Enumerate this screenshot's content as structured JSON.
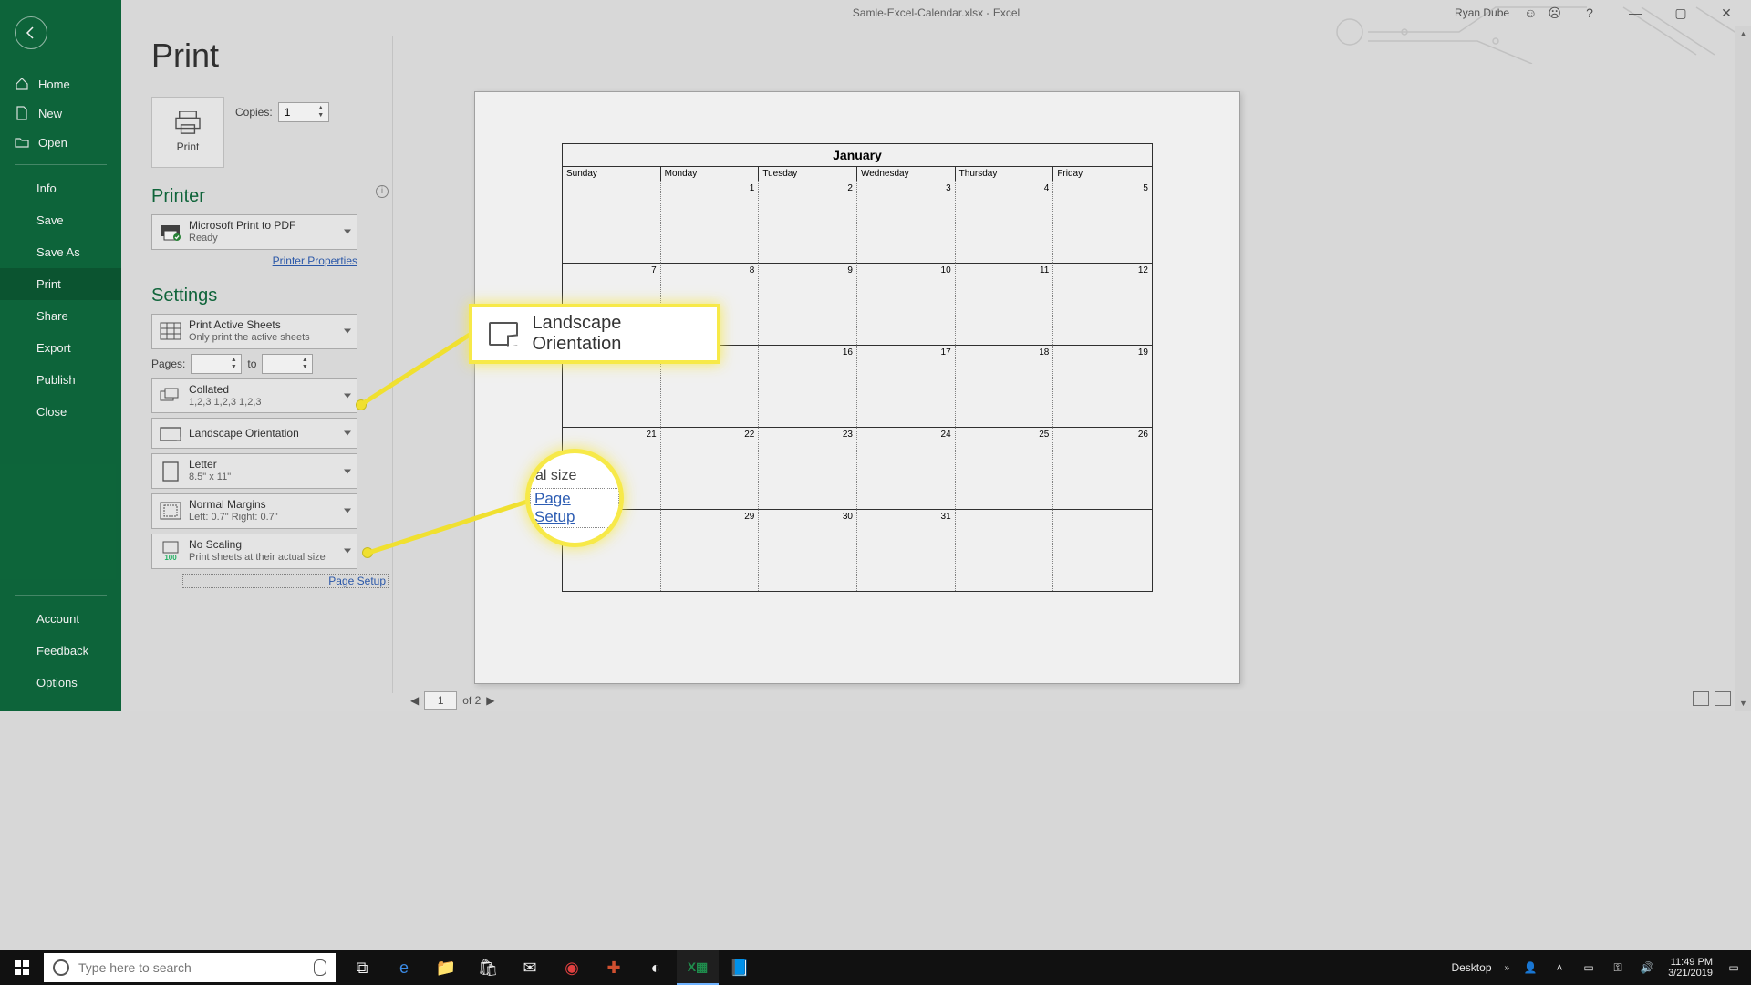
{
  "titlebar": {
    "filename": "Samle-Excel-Calendar.xlsx  -  Excel",
    "username": "Ryan Dube"
  },
  "sidebar": {
    "home": "Home",
    "new": "New",
    "open": "Open",
    "info": "Info",
    "save": "Save",
    "save_as": "Save As",
    "print": "Print",
    "share": "Share",
    "export": "Export",
    "publish": "Publish",
    "close": "Close",
    "account": "Account",
    "feedback": "Feedback",
    "options": "Options"
  },
  "main": {
    "heading": "Print",
    "print_btn": "Print",
    "copies_label": "Copies:",
    "copies_value": "1",
    "printer_heading": "Printer",
    "printer_name": "Microsoft Print to PDF",
    "printer_status": "Ready",
    "printer_properties": "Printer Properties",
    "settings_heading": "Settings",
    "sheets_title": "Print Active Sheets",
    "sheets_sub": "Only print the active sheets",
    "pages_label": "Pages:",
    "pages_to": "to",
    "collated_title": "Collated",
    "collated_sub": "1,2,3    1,2,3    1,2,3",
    "orientation_title": "Landscape Orientation",
    "letter_title": "Letter",
    "letter_sub": "8.5\" x 11\"",
    "margins_title": "Normal Margins",
    "margins_sub": "Left:  0.7\"    Right:  0.7\"",
    "scaling_title": "No Scaling",
    "scaling_sub": "Print sheets at their actual size",
    "scaling_badge": "100",
    "page_setup": "Page Setup"
  },
  "callout": {
    "orientation": "Landscape Orientation",
    "mag_line1": "al size",
    "mag_link": "Page Setup"
  },
  "preview": {
    "month": "January",
    "days": [
      "Sunday",
      "Monday",
      "Tuesday",
      "Wednesday",
      "Thursday",
      "Friday"
    ],
    "rows": [
      [
        "",
        "1",
        "2",
        "3",
        "4",
        "5"
      ],
      [
        "7",
        "8",
        "9",
        "10",
        "11",
        "12"
      ],
      [
        "",
        "",
        "16",
        "17",
        "18",
        "19"
      ],
      [
        "21",
        "22",
        "23",
        "24",
        "25",
        "26"
      ],
      [
        "",
        "29",
        "30",
        "31",
        "",
        ""
      ]
    ],
    "nav_page": "1",
    "nav_total": "of 2"
  },
  "taskbar": {
    "search_placeholder": "Type here to search",
    "desktop_label": "Desktop",
    "time": "11:49 PM",
    "date": "3/21/2019"
  }
}
